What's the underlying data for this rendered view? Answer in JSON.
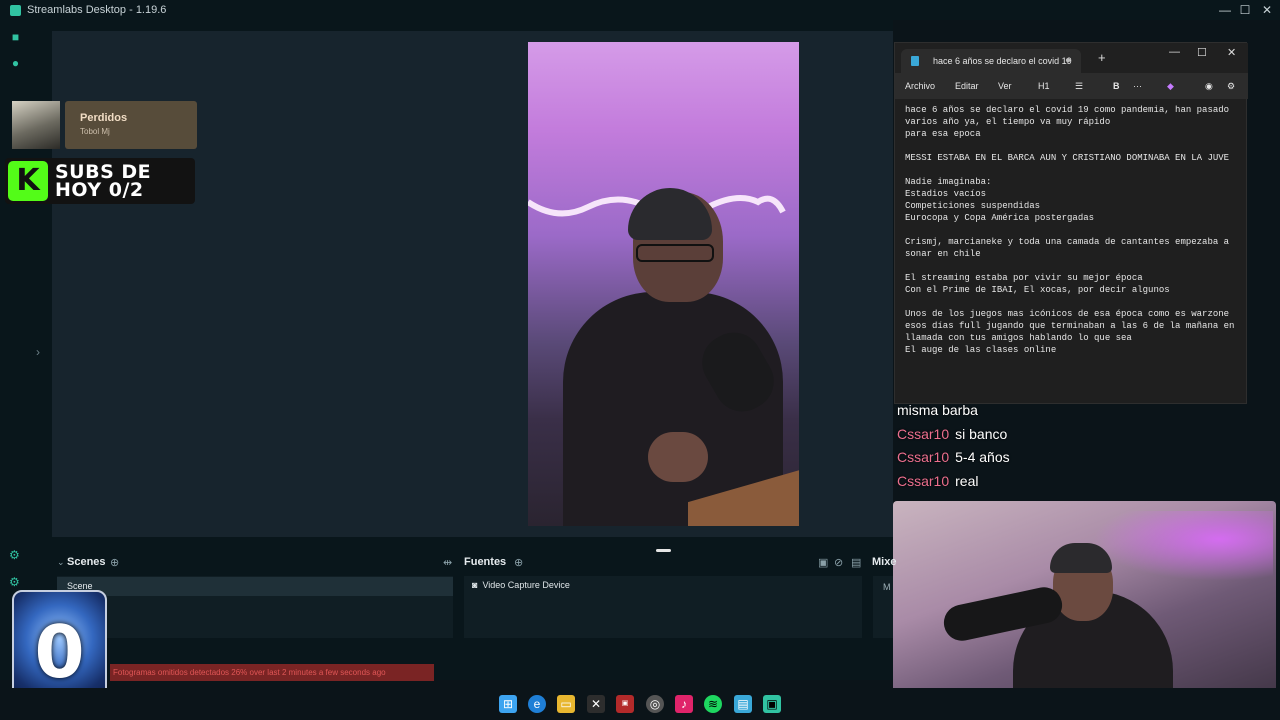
{
  "window": {
    "title": "Streamlabs Desktop - 1.19.6"
  },
  "now_playing": {
    "title": "Perdidos",
    "artist": "Tobol Mj"
  },
  "subs_overlay": {
    "label_line1": "SUBS DE",
    "label_line2": "HOY 0/2",
    "logo_letter": "K"
  },
  "notepad": {
    "tab_title": "hace 6 años se declaro el covid 19",
    "tab_unsaved_dot": "●",
    "new_tab": "+",
    "menu": {
      "file": "Archivo",
      "edit": "Editar",
      "view": "Ver",
      "heading": "H1",
      "bold": "B",
      "more": "···"
    },
    "lines": [
      "hace 6 años se declaro el covid 19 como pandemia, han pasado",
      "varios año ya, el tiempo va muy rápido",
      "para esa epoca",
      "",
      "MESSI ESTABA EN EL BARCA AUN Y CRISTIANO DOMINABA EN LA JUVE",
      "",
      "Nadie imaginaba:",
      "Estadios vacíos",
      "Competiciones suspendidas",
      "Eurocopa y Copa América postergadas",
      "",
      "Crismj, marcianeke y toda una camada de cantantes empezaba a",
      "sonar en chile",
      "",
      "El streaming estaba por vivir su mejor época",
      "Con el Prime de IBAI, El xocas, por decir algunos",
      "",
      "Unos de los juegos mas icónicos de esa época como es warzone",
      "esos días full jugando que terminaban a las 6 de la mañana en",
      "llamada con tus amigos hablando lo que sea",
      "El auge de las clases online"
    ]
  },
  "chat": [
    {
      "user": "",
      "message": "misma barba"
    },
    {
      "user": "Cssar10",
      "message": "si banco"
    },
    {
      "user": "Cssar10",
      "message": "5-4 años"
    },
    {
      "user": "Cssar10",
      "message": "real"
    }
  ],
  "dock": {
    "scenes_title": "Scenes",
    "sources_title": "Fuentes",
    "mixer_title": "Mixe",
    "scenes": [
      "Scene"
    ],
    "sources": [
      "Video Capture Device"
    ],
    "mixer_item": "M"
  },
  "alert": {
    "text": "Fotogramas omitidos detectados 26% over last 2 minutes a few seconds ago"
  },
  "badge": {
    "value": "0"
  },
  "colors": {
    "accent": "#31c3a2",
    "chat_user": "#ec6f8e",
    "alert_bg": "#7a2424",
    "kick_green": "#53fc18"
  },
  "icons": [
    "streamlabs-app-icon",
    "editor-icon",
    "record-icon",
    "windows-start-icon",
    "edge-icon",
    "file-explorer-icon",
    "excel-icon",
    "chrome-icon",
    "tiktok-icon",
    "spotify-icon",
    "notepad-icon",
    "streamlabs-taskbar-icon"
  ]
}
